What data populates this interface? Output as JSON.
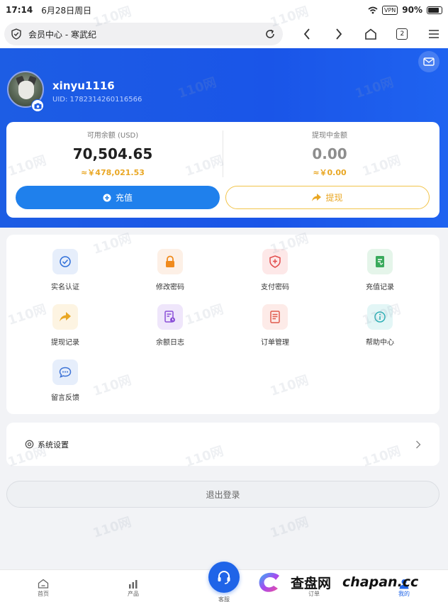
{
  "status_bar": {
    "time": "17:14",
    "date": "6月28日周日",
    "vpn": "VPN",
    "battery": "90%"
  },
  "browser": {
    "page_title": "会员中心 - 寒武纪",
    "tab_count": "2"
  },
  "profile": {
    "username": "xinyu1116",
    "uid": "UID: 1782314260116566"
  },
  "balance": {
    "available_label": "可用余额 (USD)",
    "available_amount": "70,504.65",
    "available_cny": "≈￥478,021.53",
    "withdrawing_label": "提现中金额",
    "withdrawing_amount": "0.00",
    "withdrawing_cny": "≈￥0.00",
    "recharge_label": "充值",
    "withdraw_label": "提现"
  },
  "menu": {
    "items": [
      {
        "label": "实名认证",
        "icon": "verified-check-icon",
        "color": "#2f6fd9"
      },
      {
        "label": "修改密码",
        "icon": "lock-icon",
        "color": "#f08a1c"
      },
      {
        "label": "支付密码",
        "icon": "shield-plus-icon",
        "color": "#e24c4c"
      },
      {
        "label": "充值记录",
        "icon": "recharge-record-icon",
        "color": "#3aaa5c"
      },
      {
        "label": "提现记录",
        "icon": "withdraw-arrow-icon",
        "color": "#e9a724"
      },
      {
        "label": "余额日志",
        "icon": "balance-log-icon",
        "color": "#8a4fd8"
      },
      {
        "label": "订单管理",
        "icon": "order-document-icon",
        "color": "#e05a4c"
      },
      {
        "label": "帮助中心",
        "icon": "info-icon",
        "color": "#2fb0b6"
      },
      {
        "label": "留言反馈",
        "icon": "chat-bubble-icon",
        "color": "#3d73d6"
      }
    ]
  },
  "settings": {
    "label": "系统设置"
  },
  "logout": {
    "label": "退出登录"
  },
  "tabbar": {
    "home": "首页",
    "products": "产品",
    "service": "客服",
    "orders": "订单",
    "mine": "我的"
  },
  "overlay": {
    "brand_cn": "查盘网",
    "brand_en": "chapan.cc",
    "watermark": "110网"
  }
}
